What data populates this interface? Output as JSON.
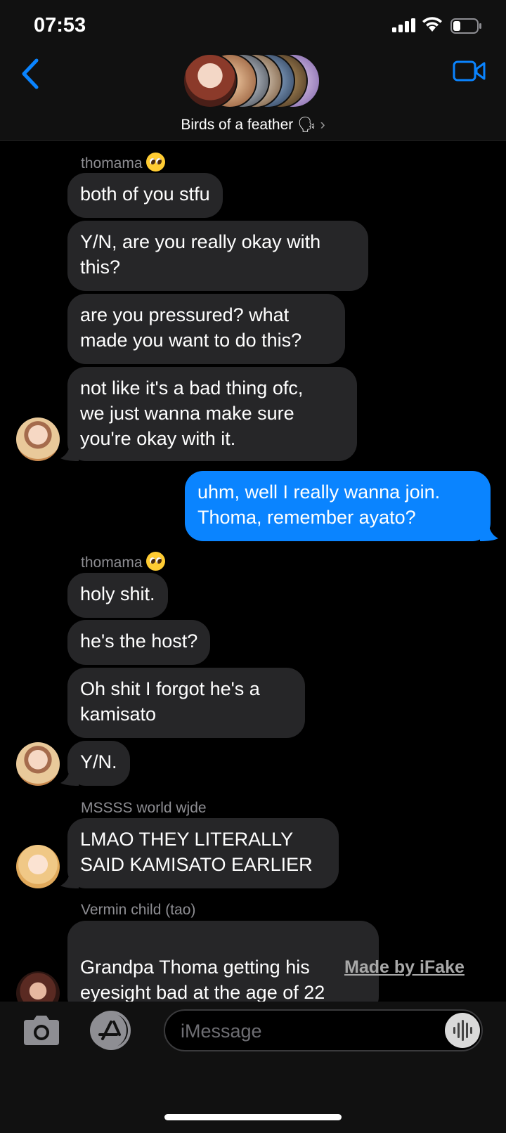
{
  "status_bar": {
    "time": "07:53"
  },
  "header": {
    "group_name": "Birds of a feather",
    "group_emoji": "🗣",
    "chevron": "›"
  },
  "messages": [
    {
      "sender": "thomama",
      "sender_emoji": "pleading-face-emoji",
      "lines": [
        "both of you stfu"
      ]
    },
    {
      "text": "Y/N, are you really okay with\nthis?"
    },
    {
      "text": "are you pressured? what\nmade you want to do this?"
    },
    {
      "text": "not like it's a bad thing ofc,\nwe just wanna make sure\nyou're okay with it."
    },
    {
      "outgoing": true,
      "text": "uhm, well I really wanna join.\nThoma, remember ayato?"
    },
    {
      "sender": "thomama",
      "text": "holy shit."
    },
    {
      "text": "he's the host?"
    },
    {
      "text": "Oh shit I forgot he's a\nkamisato"
    },
    {
      "text": "Y/N."
    },
    {
      "sender": "MSSSS world wjde",
      "text": "LMAO THEY LITERALLY\nSAID KAMISATO EARLIER"
    },
    {
      "sender": "Vermin child (tao)",
      "text": "Grandpa Thoma getting his\neyesight bad at the age of 22",
      "suffix": "..."
    }
  ],
  "watermark": "Made by iFake",
  "composer": {
    "placeholder": "iMessage"
  },
  "icons": {
    "back": "chevron-left-icon",
    "video": "video-camera-icon",
    "camera": "camera-icon",
    "apps": "app-store-icon",
    "audio": "waveform-icon"
  },
  "colors": {
    "accent": "#0a84ff",
    "bubble_incoming": "#262628",
    "background": "#000000"
  }
}
